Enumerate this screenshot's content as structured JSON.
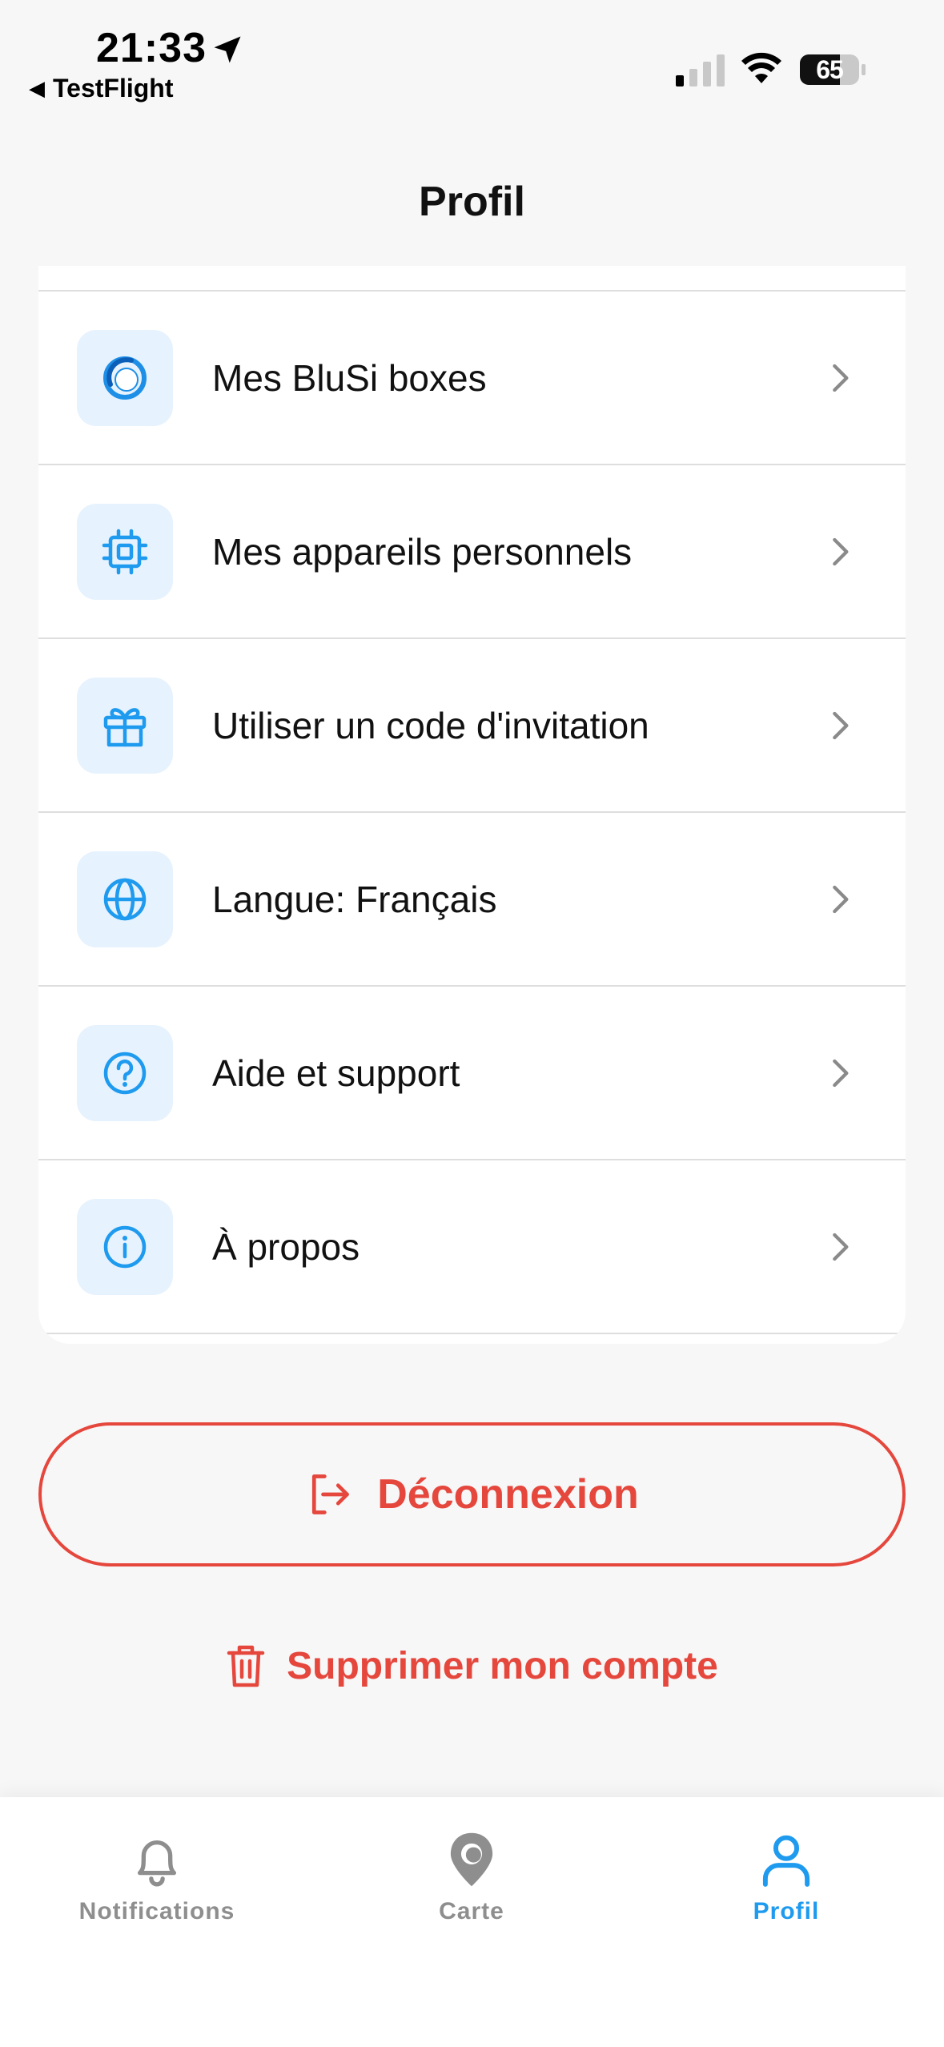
{
  "status_bar": {
    "time": "21:33",
    "back_app": "TestFlight",
    "battery": "65"
  },
  "header": {
    "title": "Profil"
  },
  "menu": {
    "items": [
      {
        "label": "Mes BluSi boxes",
        "icon": "blusi-logo-icon"
      },
      {
        "label": "Mes appareils personnels",
        "icon": "chip-icon"
      },
      {
        "label": "Utiliser un code d'invitation",
        "icon": "gift-icon"
      },
      {
        "label": "Langue: Français",
        "icon": "globe-icon"
      },
      {
        "label": "Aide et support",
        "icon": "help-icon"
      },
      {
        "label": "À propos",
        "icon": "info-icon"
      }
    ]
  },
  "actions": {
    "logout_label": "Déconnexion",
    "delete_account_label": "Supprimer mon compte"
  },
  "tab_bar": {
    "tabs": [
      {
        "label": "Notifications",
        "icon": "bell-icon",
        "active": false
      },
      {
        "label": "Carte",
        "icon": "map-pin-icon",
        "active": false
      },
      {
        "label": "Profil",
        "icon": "user-icon",
        "active": true
      }
    ]
  },
  "colors": {
    "accent": "#1e9aef",
    "danger": "#e5473d",
    "icon_bg": "#e6f2fd",
    "inactive": "#8e8e8e"
  }
}
